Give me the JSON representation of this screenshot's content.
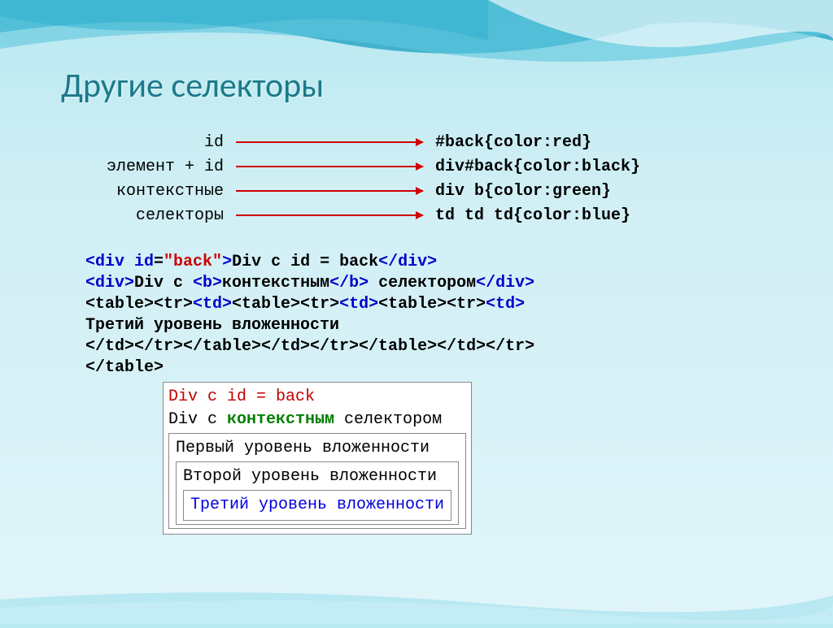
{
  "title": "Другие селекторы",
  "rows": [
    {
      "label": "id",
      "code": "#back{color:red}"
    },
    {
      "label": "элемент + id",
      "code": "div#back{color:black}"
    },
    {
      "label": "контекстные",
      "code": "div b{color:green}"
    },
    {
      "label": "селекторы",
      "code": "td td td{color:blue}"
    }
  ],
  "html_lines": {
    "l1_open": "<div ",
    "l1_attr": "id",
    "l1_eq": "=",
    "l1_val": "\"back\"",
    "l1_close": ">",
    "l1_text": "Div с id = back",
    "l1_end": "</div>",
    "l2_open": "<div>",
    "l2_t1": "Div с ",
    "l2_bopen": "<b>",
    "l2_btext": "контекстным",
    "l2_bclose": "</b>",
    "l2_t2": " селектором",
    "l2_end": "</div>",
    "l3_a": "<table><tr>",
    "l3_b": "<td>",
    "l3_c": "<table><tr>",
    "l3_d": "<td>",
    "l3_e": "<table><tr>",
    "l3_f": "<td>",
    "l4": "Третий уровень вложенности",
    "l5": "</td></tr></table></td></tr></table></td></tr>",
    "l6": "</table>"
  },
  "preview": {
    "line1": "Div с id = back",
    "line2_a": "Div с ",
    "line2_b": "контекстным",
    "line2_c": " селектором",
    "nest1": "Первый уровень вложенности",
    "nest2": "Второй уровень вложенности",
    "nest3": "Третий уровень вложенности"
  }
}
